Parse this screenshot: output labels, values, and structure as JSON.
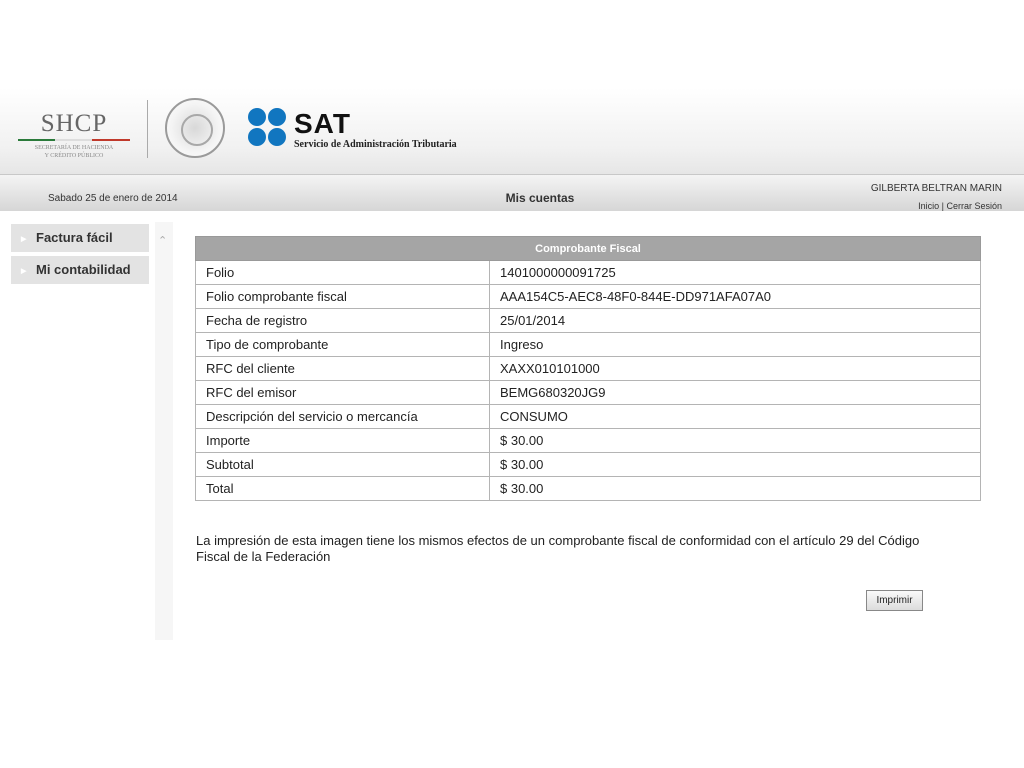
{
  "header": {
    "shcp_logo": {
      "text": "SHCP",
      "subtitle": [
        "SECRETARÍA DE HACIENDA",
        "Y CRÉDITO PÚBLICO"
      ]
    },
    "seal": "Estados Unidos Mexicanos seal",
    "sat_logo": {
      "text": "SAT",
      "subtitle": "Servicio de Administración Tributaria",
      "color": "#1176c0"
    }
  },
  "topbar": {
    "date": "Sabado 25 de enero de 2014",
    "title": "Mis cuentas",
    "user_name": "GILBERTA BELTRAN MARIN",
    "links": {
      "home": "Inicio",
      "separator": "|",
      "logout": "Cerrar Sesión"
    }
  },
  "sidebar": {
    "items": [
      {
        "label": "Factura fácil",
        "icon": "triangle-right-icon"
      },
      {
        "label": "Mi contabilidad",
        "icon": "triangle-right-icon"
      }
    ],
    "collapse_icon": "chevron-up-icon"
  },
  "receipt": {
    "title": "Comprobante Fiscal",
    "rows": [
      {
        "label": "Folio",
        "value": "1401000000091725"
      },
      {
        "label": "Folio comprobante fiscal",
        "value": "AAA154C5-AEC8-48F0-844E-DD971AFA07A0"
      },
      {
        "label": "Fecha de registro",
        "value": "25/01/2014"
      },
      {
        "label": "Tipo de comprobante",
        "value": "Ingreso"
      },
      {
        "label": "RFC del cliente",
        "value": "XAXX010101000"
      },
      {
        "label": "RFC del emisor",
        "value": "BEMG680320JG9"
      },
      {
        "label": "Descripción del servicio o mercancía",
        "value": "CONSUMO"
      },
      {
        "label": "Importe",
        "value": "$ 30.00"
      },
      {
        "label": "Subtotal",
        "value": "$ 30.00"
      },
      {
        "label": "Total",
        "value": "$ 30.00"
      }
    ]
  },
  "notice": "La impresión de esta imagen tiene los mismos efectos de un comprobante fiscal de conformidad con el artículo 29 del Código Fiscal de la Federación",
  "print_button": "Imprimir"
}
